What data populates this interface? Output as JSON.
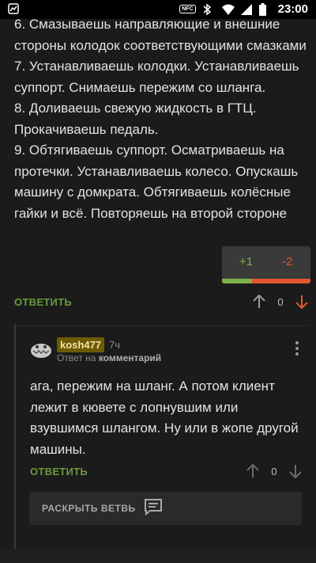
{
  "status_bar": {
    "time": "23:00",
    "nfc_label": "NFC"
  },
  "comment": {
    "text": "6. Смазываешь направляющие и внешние стороны колодок соответствующими смазками\n7. Устанавливаешь колодки. Устанавливаешь суппорт. Снимаешь пережим со шланга.\n8. Доливаешь свежую жидкость в ГТЦ. Прокачиваешь педаль.\n9. Обтягиваешь суппорт. Осматриваешь на протечки. Устанавливаешь колесо. Опускашь машину с домкрата. Обтягиваешь колёсные гайки и всё. Повторяешь на второй стороне",
    "reply_label": "ОТВЕТИТЬ",
    "rating": "0"
  },
  "vote_popup": {
    "plus": "+1",
    "minus": "-2",
    "plus_color": "#7bb24a",
    "minus_color": "#e0562f"
  },
  "reply": {
    "username": "kosh477",
    "time": "7ч",
    "reply_to_prefix": "Ответ на",
    "reply_to_target": "комментарий",
    "text": "ага, пережим на шланг. А потом клиент лежит в кювете с лопнувшим или взувшимся шлангом. Ну или в жопе другой машины.",
    "reply_label": "ОТВЕТИТЬ",
    "rating": "0"
  },
  "expand_thread": {
    "label": "РАСКРЫТЬ ВЕТВЬ"
  },
  "colors": {
    "accent_green": "#6b9a3b",
    "downvote_red": "#e0562f",
    "username_badge": "#6d5a05"
  }
}
